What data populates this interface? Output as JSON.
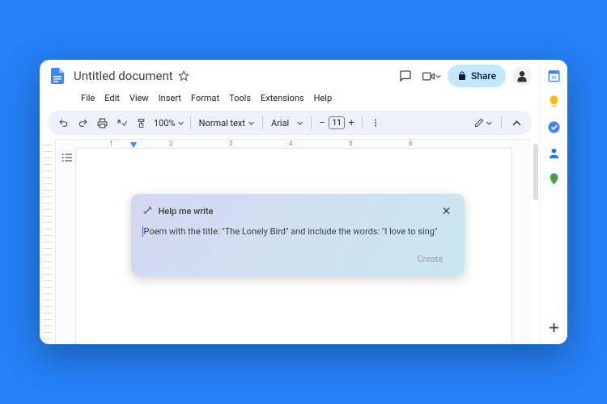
{
  "document": {
    "title": "Untitled document"
  },
  "menus": [
    "File",
    "Edit",
    "View",
    "Insert",
    "Format",
    "Tools",
    "Extensions",
    "Help"
  ],
  "share": {
    "label": "Share"
  },
  "toolbar": {
    "zoom": "100%",
    "paragraph_style": "Normal text",
    "font": "Arial",
    "font_size": "11"
  },
  "ruler": {
    "marks": [
      "1",
      "2",
      "3",
      "4",
      "5",
      "6"
    ]
  },
  "help_me_write": {
    "title": "Help me write",
    "prompt": "Poem with the title: \"The Lonely Bird\" and include the words: \"I love to sing\"",
    "create_label": "Create"
  },
  "sidepanel_icons": [
    "calendar-icon",
    "keep-icon",
    "tasks-icon",
    "contacts-icon",
    "maps-icon",
    "add-icon"
  ]
}
